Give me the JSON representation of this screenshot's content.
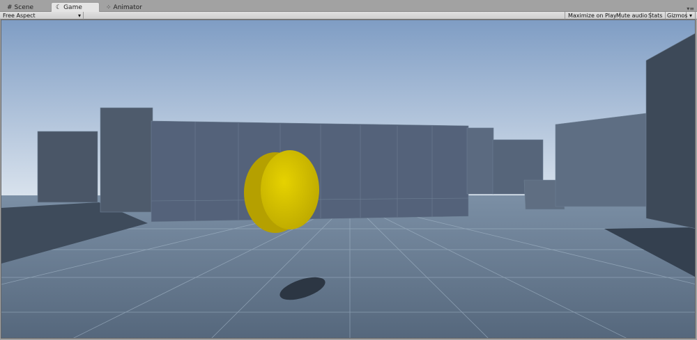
{
  "tabs": [
    {
      "label": "Scene",
      "icon": "grid-icon"
    },
    {
      "label": "Game",
      "icon": "pacman-icon",
      "active": true
    },
    {
      "label": "Animator",
      "icon": "animator-icon"
    }
  ],
  "toolbar": {
    "aspect": "Free Aspect",
    "maximize": "Maximize on Play",
    "mute": "Mute audio",
    "stats": "Stats",
    "gizmos": "Gizmos"
  },
  "colors": {
    "coin": "#d8c400",
    "sky_top": "#8aa6c8",
    "floor": "#5c6e82",
    "wall": "#4a5667"
  }
}
